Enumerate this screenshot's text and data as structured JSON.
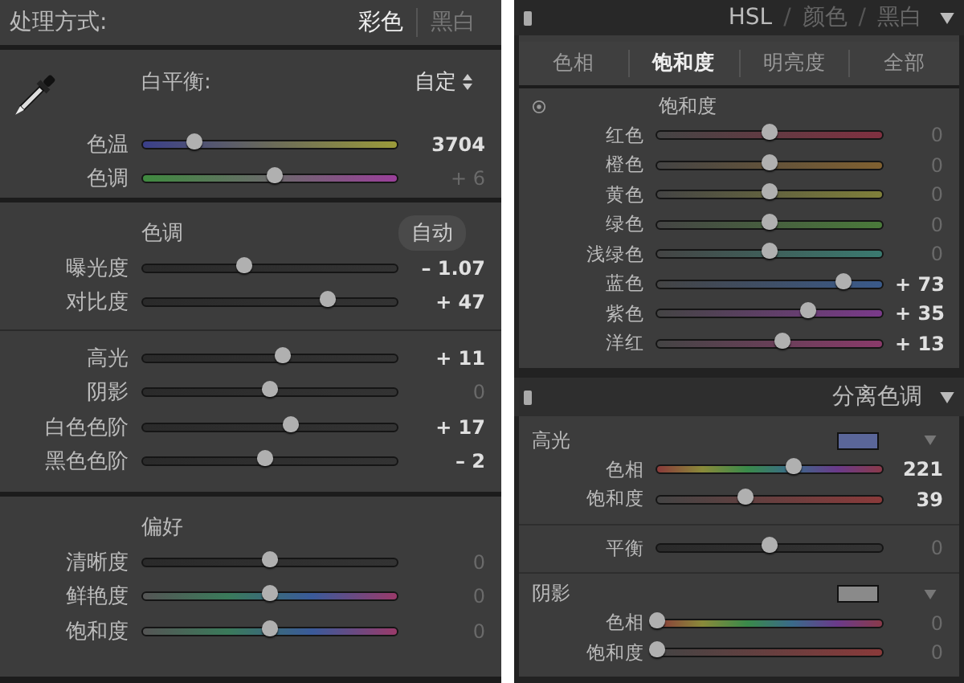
{
  "basic": {
    "treatment": {
      "label": "处理方式:",
      "options": [
        {
          "label": "彩色",
          "selected": true
        },
        {
          "label": "黑白",
          "selected": false
        }
      ]
    },
    "white_balance": {
      "label": "白平衡:",
      "preset": "自定",
      "sliders": [
        {
          "label": "色温",
          "kind": "temp",
          "level": 0.2,
          "reading": "3704",
          "highlighted": true
        },
        {
          "label": "色调",
          "kind": "tint",
          "level": 0.52,
          "reading": "+ 6",
          "highlighted": false
        }
      ]
    },
    "tone": {
      "title": "色调",
      "auto_button": "自动",
      "groups": [
        [
          {
            "label": "曝光度",
            "kind": "plain",
            "level": 0.4,
            "reading": "– 1.07",
            "highlighted": true
          },
          {
            "label": "对比度",
            "kind": "plain",
            "level": 0.73,
            "reading": "+ 47",
            "highlighted": true
          }
        ],
        [
          {
            "label": "高光",
            "kind": "plain",
            "level": 0.55,
            "reading": "+ 11",
            "highlighted": true
          },
          {
            "label": "阴影",
            "kind": "plain",
            "level": 0.5,
            "reading": "0",
            "highlighted": false
          },
          {
            "label": "白色色阶",
            "kind": "plain",
            "level": 0.58,
            "reading": "+ 17",
            "highlighted": true
          },
          {
            "label": "黑色色阶",
            "kind": "plain",
            "level": 0.48,
            "reading": "– 2",
            "highlighted": true
          }
        ]
      ]
    },
    "presence": {
      "title": "偏好",
      "sliders": [
        {
          "label": "清晰度",
          "kind": "plain",
          "level": 0.5,
          "reading": "0",
          "highlighted": false
        },
        {
          "label": "鲜艳度",
          "kind": "vibrance",
          "level": 0.5,
          "reading": "0",
          "highlighted": false
        },
        {
          "label": "饱和度",
          "kind": "vibrance",
          "level": 0.5,
          "reading": "0",
          "highlighted": false
        }
      ]
    }
  },
  "hsl": {
    "header": {
      "separator": "/",
      "tabs": [
        {
          "label": "HSL",
          "selected": true
        },
        {
          "label": "颜色",
          "selected": false
        },
        {
          "label": "黑白",
          "selected": false
        }
      ]
    },
    "subtabs": [
      {
        "label": "色相",
        "selected": false
      },
      {
        "label": "饱和度",
        "selected": true
      },
      {
        "label": "明亮度",
        "selected": false
      },
      {
        "label": "全部",
        "selected": false
      }
    ],
    "section_title": "饱和度",
    "sliders": [
      {
        "label": "红色",
        "kind": "red",
        "level": 0.5,
        "reading": "0",
        "highlighted": false
      },
      {
        "label": "橙色",
        "kind": "orange",
        "level": 0.5,
        "reading": "0",
        "highlighted": false
      },
      {
        "label": "黄色",
        "kind": "yellow",
        "level": 0.5,
        "reading": "0",
        "highlighted": false
      },
      {
        "label": "绿色",
        "kind": "green",
        "level": 0.5,
        "reading": "0",
        "highlighted": false
      },
      {
        "label": "浅绿色",
        "kind": "aqua",
        "level": 0.5,
        "reading": "0",
        "highlighted": false
      },
      {
        "label": "蓝色",
        "kind": "blue",
        "level": 0.83,
        "reading": "+ 73",
        "highlighted": true
      },
      {
        "label": "紫色",
        "kind": "purple",
        "level": 0.67,
        "reading": "+ 35",
        "highlighted": true
      },
      {
        "label": "洋红",
        "kind": "magenta",
        "level": 0.56,
        "reading": "+ 13",
        "highlighted": true
      }
    ]
  },
  "split_toning": {
    "title": "分离色调",
    "highlights": {
      "title": "高光",
      "color": "#5a6699",
      "sliders": [
        {
          "label": "色相",
          "kind": "hue",
          "level": 0.61,
          "reading": "221",
          "highlighted": true
        },
        {
          "label": "饱和度",
          "kind": "satred",
          "level": 0.39,
          "reading": "39",
          "highlighted": true
        }
      ]
    },
    "balance": {
      "label": "平衡",
      "kind": "plain",
      "level": 0.5,
      "reading": "0",
      "highlighted": false
    },
    "shadows": {
      "title": "阴影",
      "color": "#8a8a8a",
      "sliders": [
        {
          "label": "色相",
          "kind": "hue",
          "level": 0.0,
          "reading": "0",
          "highlighted": false
        },
        {
          "label": "饱和度",
          "kind": "satred",
          "level": 0.0,
          "reading": "0",
          "highlighted": false
        }
      ]
    }
  }
}
